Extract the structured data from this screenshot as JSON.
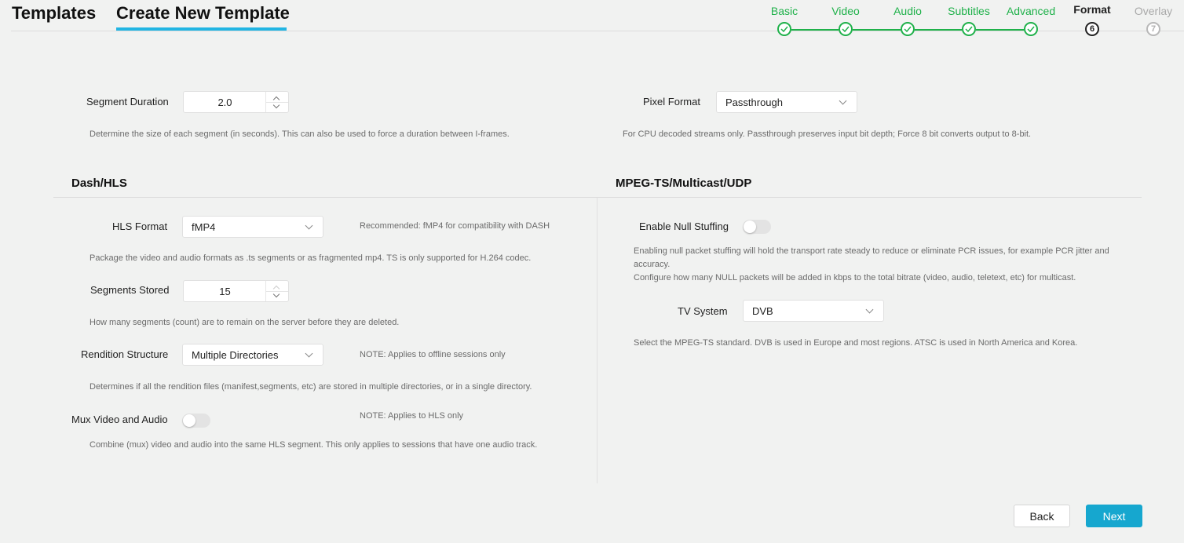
{
  "header": {
    "tabs": [
      {
        "label": "Templates"
      },
      {
        "label": "Create New Template"
      }
    ]
  },
  "stepper": {
    "steps": [
      {
        "label": "Basic",
        "state": "done"
      },
      {
        "label": "Video",
        "state": "done"
      },
      {
        "label": "Audio",
        "state": "done"
      },
      {
        "label": "Subtitles",
        "state": "done"
      },
      {
        "label": "Advanced",
        "state": "done"
      },
      {
        "label": "Format",
        "state": "current",
        "number": "6"
      },
      {
        "label": "Overlay",
        "state": "pending",
        "number": "7"
      }
    ],
    "icons": {
      "done": "check-icon"
    },
    "colors": {
      "done": "#1fb14a",
      "current": "#222222",
      "pending": "#b0b0b0"
    }
  },
  "general": {
    "segment_duration": {
      "label": "Segment Duration",
      "value": "2.0",
      "help": "Determine the size of each segment (in seconds). This can also be used to force a duration between I-frames."
    },
    "pixel_format": {
      "label": "Pixel Format",
      "value": "Passthrough",
      "help": "For CPU decoded streams only. Passthrough preserves input bit depth; Force 8 bit converts output to 8-bit."
    }
  },
  "dash_hls": {
    "title": "Dash/HLS",
    "hls_format": {
      "label": "HLS Format",
      "value": "fMP4",
      "note": "Recommended: fMP4 for compatibility with DASH",
      "help": "Package the video and audio formats as .ts segments or as fragmented mp4. TS is only supported for H.264 codec."
    },
    "segments_stored": {
      "label": "Segments Stored",
      "value": "15",
      "help": "How many segments (count) are to remain on the server before they are deleted."
    },
    "rendition_structure": {
      "label": "Rendition Structure",
      "value": "Multiple Directories",
      "note": "NOTE: Applies to offline sessions only",
      "help": "Determines if all the rendition files (manifest,segments, etc) are stored in multiple directories, or in a single directory."
    },
    "mux_video_audio": {
      "label": "Mux Video and Audio",
      "enabled": false,
      "note": "NOTE: Applies to HLS only",
      "help": "Combine (mux) video and audio into the same HLS segment. This only applies to sessions that have one audio track."
    }
  },
  "mpegts": {
    "title": "MPEG-TS/Multicast/UDP",
    "null_stuffing": {
      "label": "Enable Null Stuffing",
      "enabled": false,
      "help_line1": "Enabling null packet stuffing will hold the transport rate steady to reduce or eliminate PCR issues, for example PCR jitter and accuracy.",
      "help_line2": "Configure how many NULL packets will be added in kbps to the total bitrate (video, audio, teletext, etc) for multicast."
    },
    "tv_system": {
      "label": "TV System",
      "value": "DVB",
      "help": "Select the MPEG-TS standard. DVB is used in Europe and most regions. ATSC is used in North America and Korea."
    }
  },
  "footer": {
    "back_label": "Back",
    "next_label": "Next",
    "accent": "#16a7cf"
  }
}
